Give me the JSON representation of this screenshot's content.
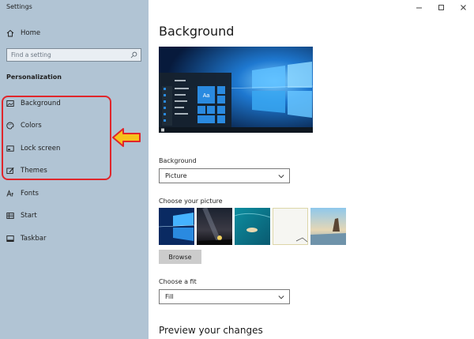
{
  "window": {
    "title": "Settings"
  },
  "sidebar": {
    "home_label": "Home",
    "search_placeholder": "Find a setting",
    "section_label": "Personalization",
    "items": [
      {
        "label": "Background",
        "icon": "image-icon"
      },
      {
        "label": "Colors",
        "icon": "palette-icon"
      },
      {
        "label": "Lock screen",
        "icon": "lock-screen-icon"
      },
      {
        "label": "Themes",
        "icon": "themes-icon"
      },
      {
        "label": "Fonts",
        "icon": "fonts-icon"
      },
      {
        "label": "Start",
        "icon": "start-icon"
      },
      {
        "label": "Taskbar",
        "icon": "taskbar-icon"
      }
    ]
  },
  "main": {
    "title": "Background",
    "preview_tile_text": "Aa",
    "background_label": "Background",
    "background_value": "Picture",
    "choose_picture_label": "Choose your picture",
    "browse_label": "Browse",
    "fit_label": "Choose a fit",
    "fit_value": "Fill",
    "preview_heading": "Preview your changes"
  },
  "colors": {
    "sidebar_bg": "#b1c4d4",
    "highlight": "#e0262b",
    "callout_fill": "#f7c21a",
    "callout_stroke": "#e0262b",
    "accent": "#0078d7"
  }
}
